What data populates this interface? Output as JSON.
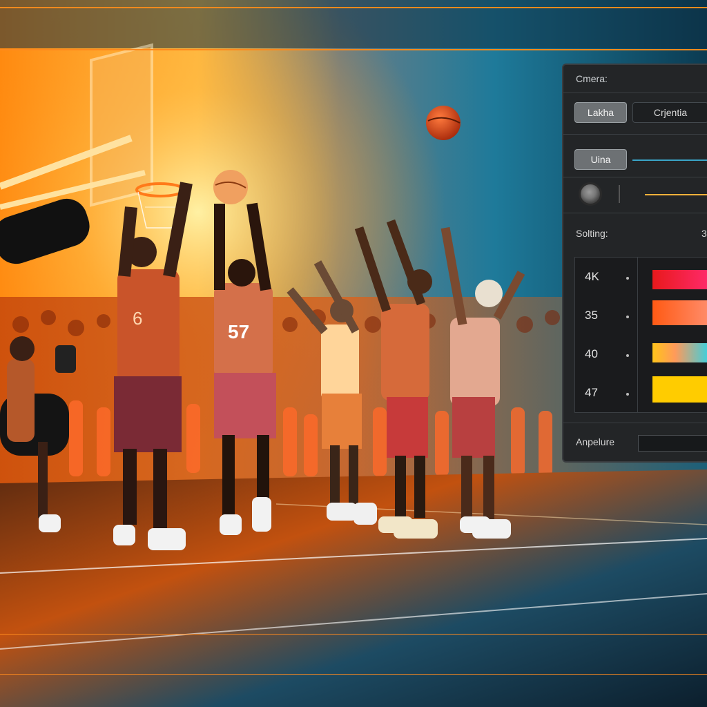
{
  "panel": {
    "title": "Cmera:",
    "buttons": {
      "primary": "Lakha",
      "secondary": "Crjentia",
      "line": "Uina"
    },
    "section_label": "Solting:",
    "section_value": "3",
    "rows": [
      {
        "label": "4K",
        "color": "#e8191c"
      },
      {
        "label": "35",
        "color": "#ff6a1a"
      },
      {
        "label": "40",
        "color": "#ffc41a"
      },
      {
        "label": "47",
        "color": "#ffcc00"
      }
    ],
    "footer_label": "Anpelure"
  },
  "scene": {
    "jerseys": [
      "6",
      "57"
    ]
  },
  "colors": {
    "accent_orange": "#ff8a1d",
    "accent_blue": "#3aa5c7",
    "panel_bg": "#232527"
  }
}
